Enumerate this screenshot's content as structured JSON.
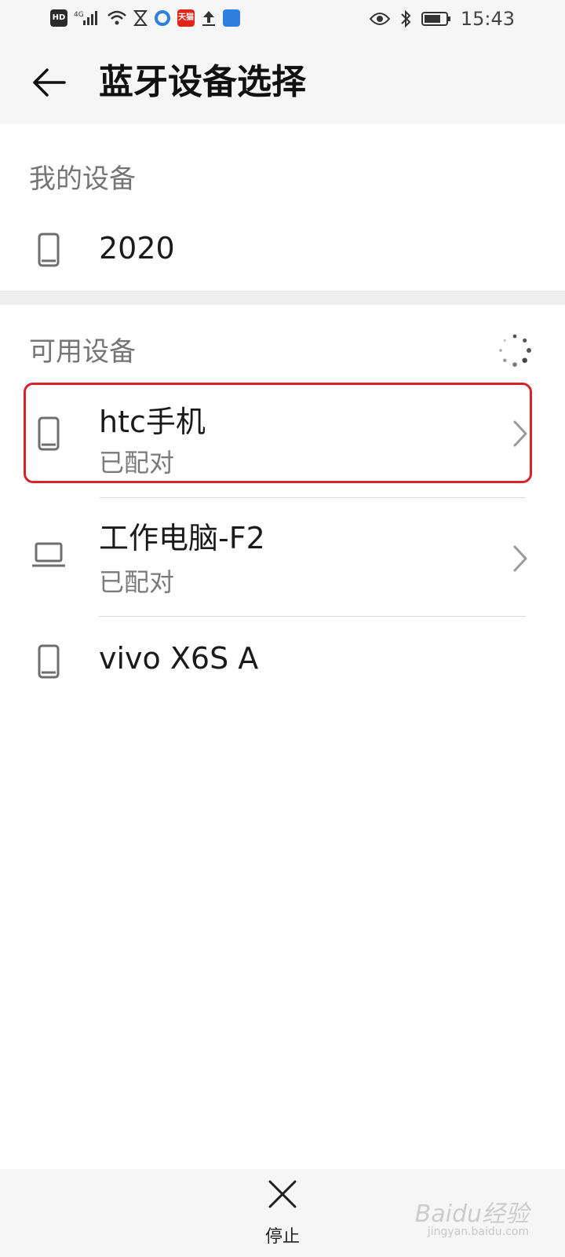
{
  "status_bar": {
    "left_icons": [
      "hd-icon",
      "signal-4g-icon",
      "wifi-icon",
      "hourglass-icon",
      "browser-icon",
      "tmall-icon",
      "upload-icon",
      "app-icon"
    ],
    "badge_hd": "HD",
    "badge_4g": "4G",
    "badge_tmall": "天猫",
    "time": "15:43"
  },
  "header": {
    "title": "蓝牙设备选择"
  },
  "my_devices": {
    "label": "我的设备",
    "items": [
      {
        "name": "2020",
        "icon": "phone-icon"
      }
    ]
  },
  "available_devices": {
    "label": "可用设备",
    "items": [
      {
        "name": "htc手机",
        "status": "已配对",
        "icon": "phone-icon",
        "highlighted": true
      },
      {
        "name": "工作电脑-F2",
        "status": "已配对",
        "icon": "laptop-icon"
      },
      {
        "name": "vivo X6S A",
        "icon": "phone-icon"
      }
    ]
  },
  "bottom": {
    "stop_label": "停止"
  },
  "watermark": {
    "text": "Baidu经验",
    "sub": "jingyan.baidu.com"
  },
  "colors": {
    "highlight": "#d8232a",
    "header_bg": "#f6f6f6",
    "secondary_text": "#7a7a7a"
  }
}
